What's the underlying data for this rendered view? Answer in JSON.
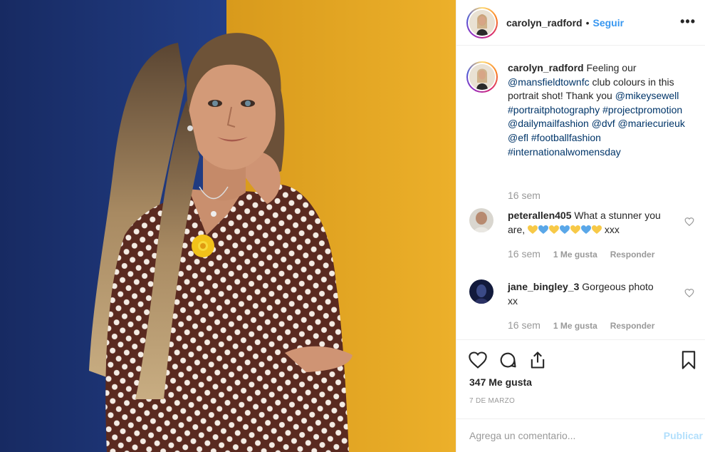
{
  "header": {
    "username": "carolyn_radford",
    "separator": "•",
    "follow_label": "Seguir",
    "more_icon": "more-dots-icon"
  },
  "caption": {
    "username": "carolyn_radford",
    "t1": "Feeling our",
    "mention1": "@mansfieldtownfc",
    "t2": "club colours in this portrait shot! Thank you",
    "mention2": "@mikeysewell",
    "tag1": "#portraitphotography",
    "tag2": "#projectpromotion",
    "mention3": "@dailymailfashion",
    "mention4": "@dvf",
    "mention5": "@mariecurieuk",
    "mention6": "@efl",
    "tag3": "#footballfashion",
    "tag4": "#internationalwomensday",
    "time": "16 sem"
  },
  "comments": [
    {
      "username": "peterallen405",
      "text_a": "What a stunner you are,",
      "text_b": "xxx",
      "emojis": [
        "yellow-heart",
        "blue-heart",
        "yellow-heart",
        "blue-heart",
        "yellow-heart",
        "blue-heart",
        "yellow-heart"
      ],
      "time": "16 sem",
      "likes": "1 Me gusta",
      "reply": "Responder"
    },
    {
      "username": "jane_bingley_3",
      "text_a": "Gorgeous photo xx",
      "time": "16 sem",
      "likes": "1 Me gusta",
      "reply": "Responder"
    }
  ],
  "actions": {
    "like_icon": "heart-icon",
    "comment_icon": "comment-icon",
    "share_icon": "share-icon",
    "save_icon": "bookmark-icon"
  },
  "likes_count": "347 Me gusta",
  "date": "7 DE MARZO",
  "add_comment": {
    "placeholder": "Agrega un comentario...",
    "post_label": "Publicar"
  },
  "colors": {
    "background_blue": "#1f3a7a",
    "background_yellow": "#e8a923",
    "link": "#003569",
    "follow": "#3897f0",
    "muted": "#999999"
  }
}
